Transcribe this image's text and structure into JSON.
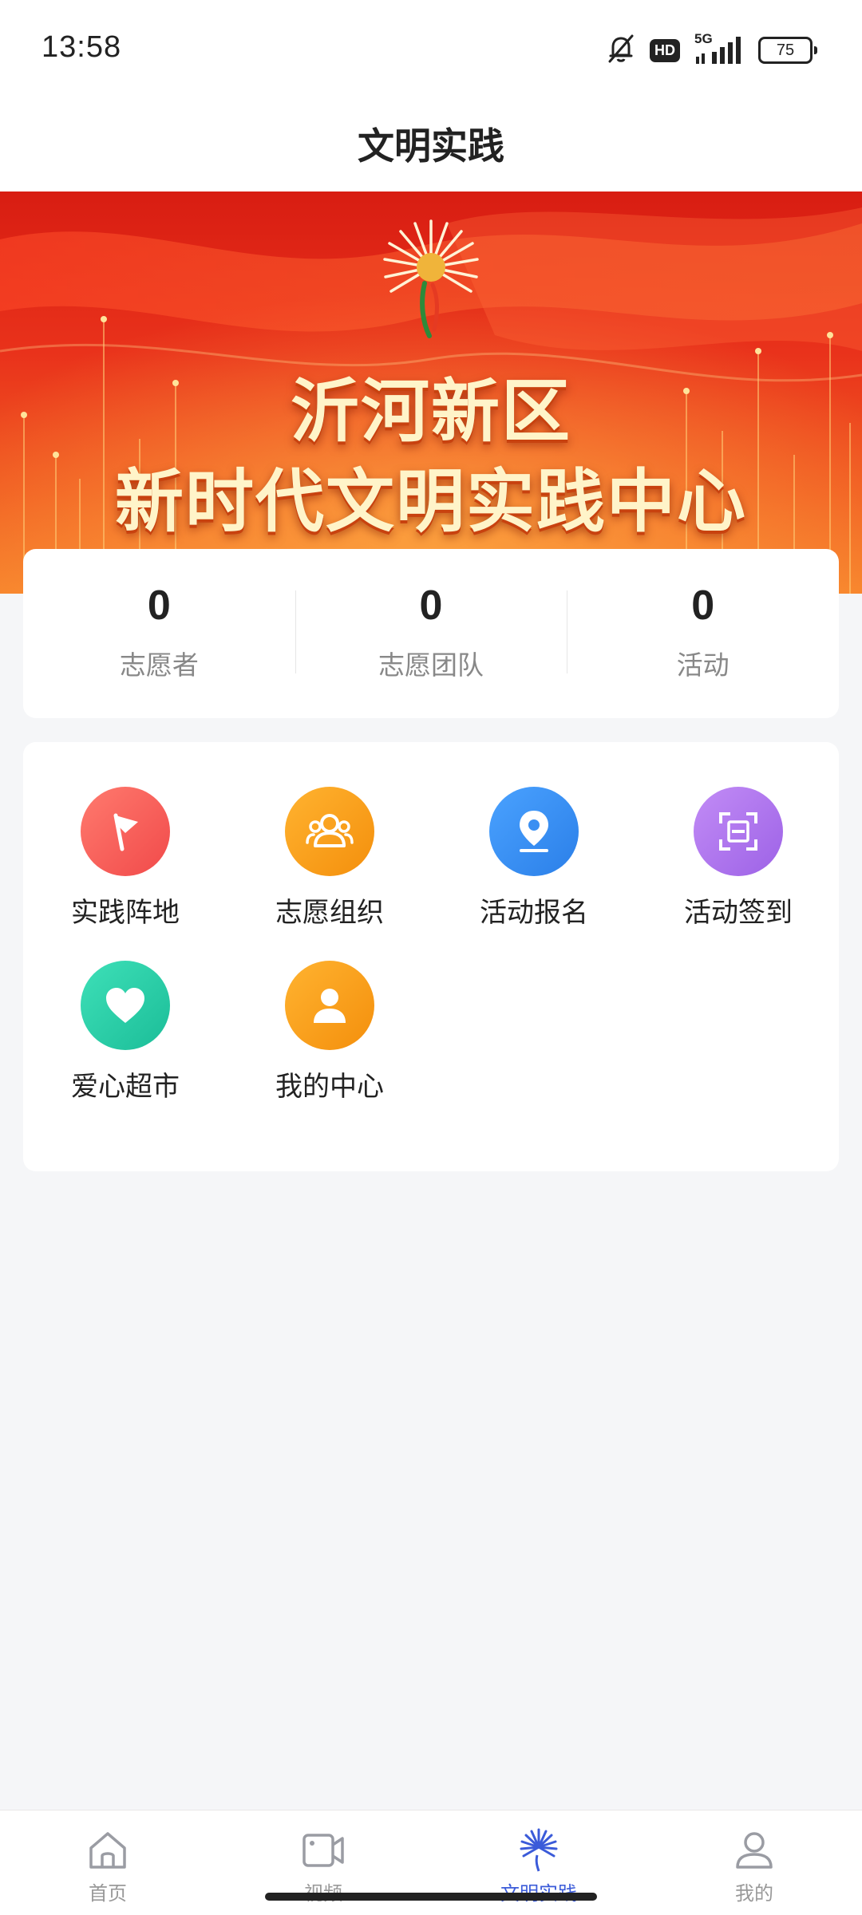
{
  "status_bar": {
    "time": "13:58",
    "hd": "HD",
    "network": "5G",
    "battery": "75"
  },
  "header": {
    "title": "文明实践"
  },
  "banner": {
    "line1": "沂河新区",
    "line2": "新时代文明实践中心"
  },
  "stats": [
    {
      "value": "0",
      "label": "志愿者"
    },
    {
      "value": "0",
      "label": "志愿团队"
    },
    {
      "value": "0",
      "label": "活动"
    }
  ],
  "menu": [
    {
      "label": "实践阵地",
      "icon": "flag-icon",
      "color": "#f45d5d"
    },
    {
      "label": "志愿组织",
      "icon": "group-icon",
      "color": "#f8a018"
    },
    {
      "label": "活动报名",
      "icon": "location-pin-icon",
      "color": "#3a8ff2"
    },
    {
      "label": "活动签到",
      "icon": "scan-icon",
      "color": "#b278ee"
    },
    {
      "label": "爱心超市",
      "icon": "heart-icon",
      "color": "#27cda7"
    },
    {
      "label": "我的中心",
      "icon": "user-icon",
      "color": "#f8a018"
    }
  ],
  "bottom_nav": [
    {
      "label": "首页",
      "icon": "home-icon",
      "active": false
    },
    {
      "label": "视频",
      "icon": "video-icon",
      "active": false
    },
    {
      "label": "文明实践",
      "icon": "civilization-logo-icon",
      "active": true
    },
    {
      "label": "我的",
      "icon": "profile-icon",
      "active": false
    }
  ],
  "colors": {
    "accent": "#3b5bd9",
    "banner_red": "#d81d12",
    "banner_orange": "#f7832c"
  }
}
